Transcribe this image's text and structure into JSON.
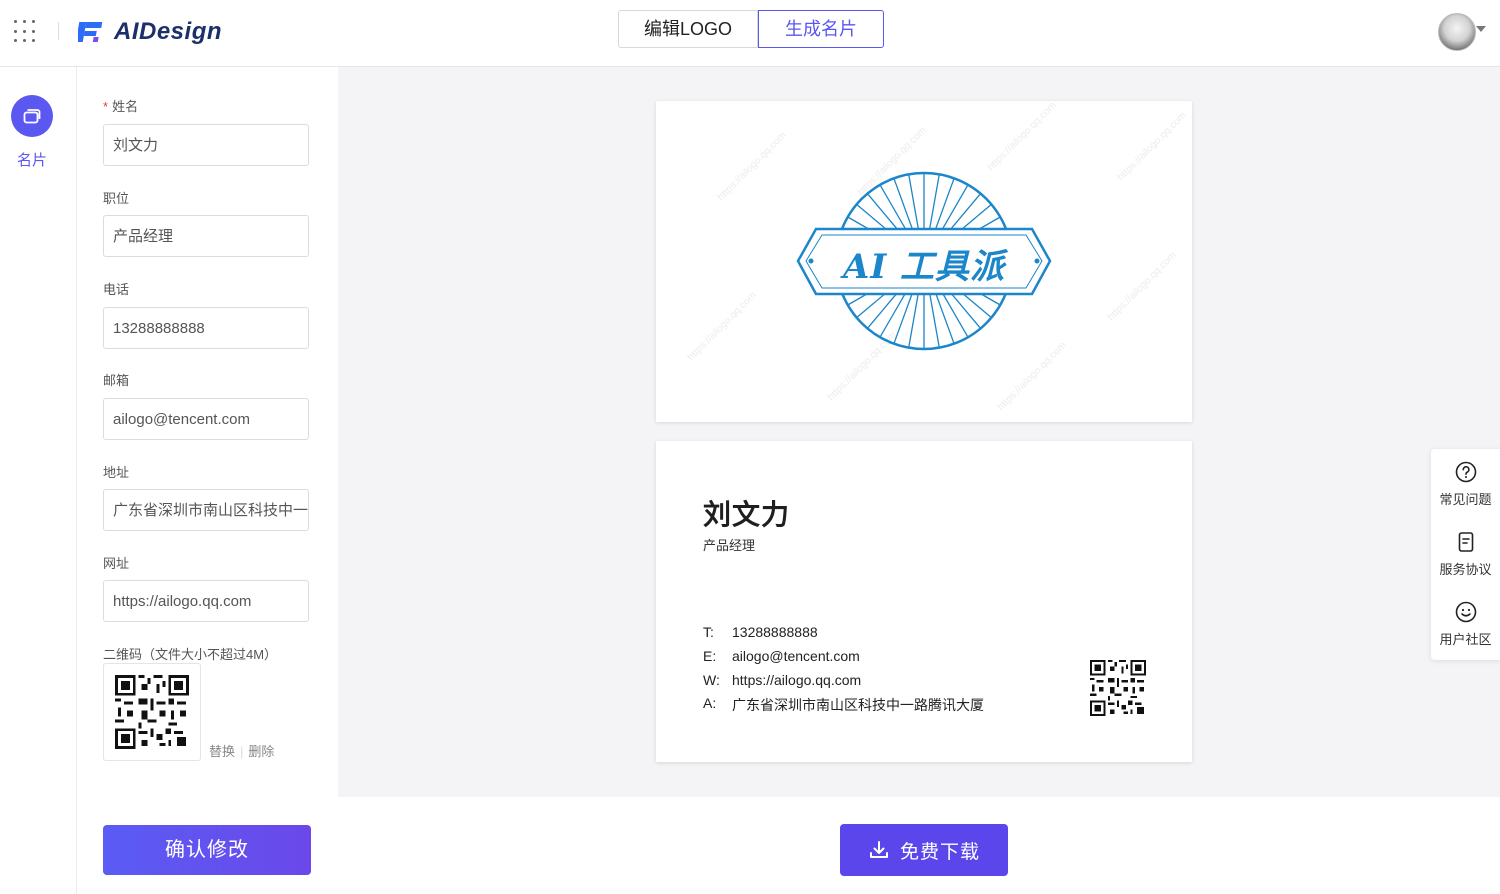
{
  "header": {
    "brand": "AIDesign",
    "tabs": [
      {
        "label": "编辑LOGO"
      },
      {
        "label": "生成名片"
      }
    ]
  },
  "rail": {
    "items": [
      {
        "label": "名片"
      }
    ]
  },
  "form": {
    "fields": {
      "name": {
        "label": "姓名",
        "value": "刘文力"
      },
      "position": {
        "label": "职位",
        "value": "产品经理"
      },
      "phone": {
        "label": "电话",
        "value": "13288888888"
      },
      "email": {
        "label": "邮箱",
        "value": "ailogo@tencent.com"
      },
      "address": {
        "label": "地址",
        "value": "广东省深圳市南山区科技中一路腾讯大厦"
      },
      "website": {
        "label": "网址",
        "value": "https://ailogo.qq.com"
      }
    },
    "qr_label": "二维码（文件大小不超过4M）",
    "qr_replace": "替换",
    "qr_delete": "删除",
    "confirm_label": "确认修改"
  },
  "card_front": {
    "logo_text": "AI 工具派",
    "watermark": "https://ailogo.qq.com",
    "logo_color": "#1b86c9"
  },
  "card_back": {
    "name": "刘文力",
    "title": "产品经理",
    "rows": [
      {
        "key": "T:",
        "value": "13288888888"
      },
      {
        "key": "E:",
        "value": "ailogo@tencent.com"
      },
      {
        "key": "W:",
        "value": "https://ailogo.qq.com"
      },
      {
        "key": "A:",
        "value": "广东省深圳市南山区科技中一路腾讯大厦"
      }
    ]
  },
  "actions": {
    "download_label": "免费下载"
  },
  "help": {
    "items": [
      {
        "label": "常见问题",
        "icon": "question-icon"
      },
      {
        "label": "服务协议",
        "icon": "document-icon"
      },
      {
        "label": "用户社区",
        "icon": "smile-icon"
      }
    ]
  },
  "colors": {
    "accent": "#5b57f1",
    "button_gradient_start": "#5a5cf5",
    "button_gradient_end": "#6b48e9",
    "download": "#5b46ec"
  }
}
